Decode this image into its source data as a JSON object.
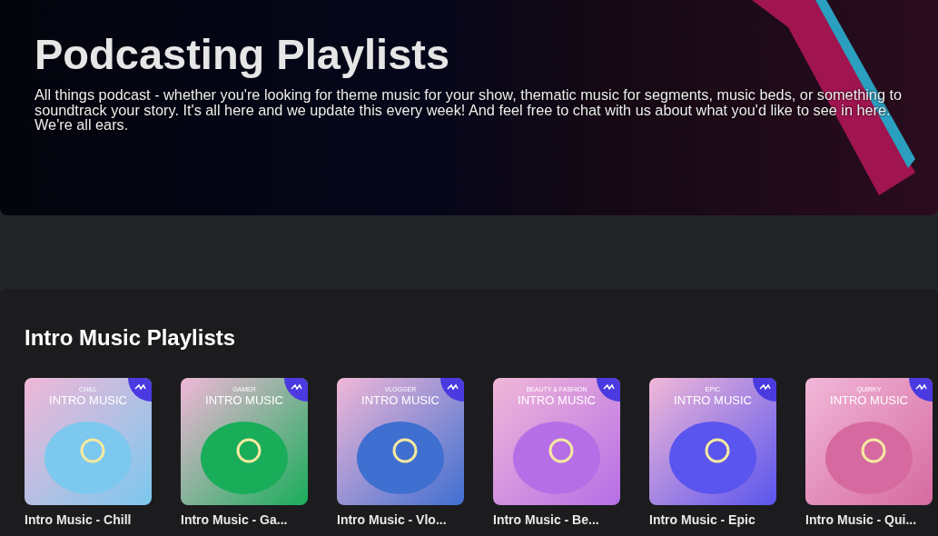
{
  "hero": {
    "title": "Podcasting Playlists",
    "description": "All things podcast - whether you're looking for theme music for your show, thematic music for segments, music beds, or something to soundtrack your story. It's all here and we update this every week! And feel free to chat with us about what you'd like to see in here. We're all ears."
  },
  "section": {
    "title": "Intro Music Playlists",
    "playlists": [
      {
        "title": "Intro Music - Chill",
        "cover_tag": "CHILL",
        "cover_title": "INTRO MUSIC",
        "color": "#7cc8ee"
      },
      {
        "title": "Intro Music - Ga...",
        "cover_tag": "GAMER",
        "cover_title": "INTRO MUSIC",
        "color": "#19ad5a"
      },
      {
        "title": "Intro Music - Vlo...",
        "cover_tag": "VLOGGER",
        "cover_title": "INTRO MUSIC",
        "color": "#3f6fd0"
      },
      {
        "title": "Intro Music - Be...",
        "cover_tag": "BEAUTY & FASHION",
        "cover_title": "INTRO MUSIC",
        "color": "#b66ee6"
      },
      {
        "title": "Intro Music - Epic",
        "cover_tag": "EPIC",
        "cover_title": "INTRO MUSIC",
        "color": "#5a55ee"
      },
      {
        "title": "Intro Music - Qui...",
        "cover_tag": "QUIRKY",
        "cover_title": "INTRO MUSIC",
        "color": "#d66aa0"
      }
    ]
  }
}
